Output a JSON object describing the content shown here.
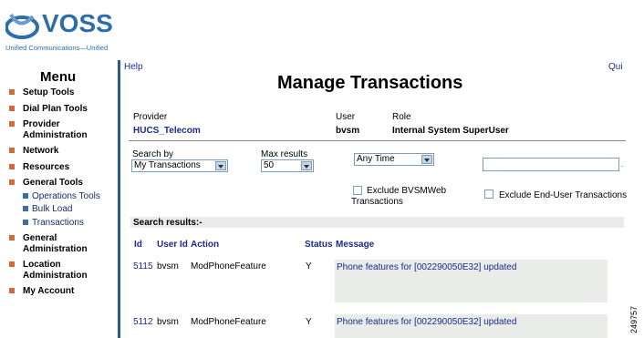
{
  "logo": {
    "word": "VOSS",
    "tagline": "Unified Communications—Unified"
  },
  "menu": {
    "title": "Menu",
    "items": [
      {
        "label": "Setup Tools",
        "sub": false
      },
      {
        "label": "Dial Plan Tools",
        "sub": false
      },
      {
        "label": "Provider Administration",
        "sub": false
      },
      {
        "label": "Network",
        "sub": false
      },
      {
        "label": "Resources",
        "sub": false
      },
      {
        "label": "General Tools",
        "sub": false
      },
      {
        "label": "Operations Tools",
        "sub": true
      },
      {
        "label": "Bulk Load",
        "sub": true
      },
      {
        "label": "Transactions",
        "sub": true
      },
      {
        "label": "General Administration",
        "sub": false
      },
      {
        "label": "Location Administration",
        "sub": false
      },
      {
        "label": "My Account",
        "sub": false
      }
    ]
  },
  "header": {
    "help": "Help",
    "quick": "Qui",
    "title": "Manage Transactions"
  },
  "context": {
    "provider_label": "Provider",
    "provider_value": "HUCS_Telecom",
    "user_label": "User",
    "user_value": "bvsm",
    "role_label": "Role",
    "role_value": "Internal System SuperUser"
  },
  "search": {
    "search_by_label": "Search by",
    "search_by_value": "My Transactions",
    "max_results_label": "Max results",
    "max_results_value": "50",
    "time_value": "Any Time",
    "text_value": "",
    "exclude_bvsmweb": "Exclude BVSMWeb Transactions",
    "exclude_enduser": "Exclude End-User Transactions"
  },
  "results": {
    "title": "Search results:-",
    "columns": {
      "id": "Id",
      "user_id": "User Id",
      "action": "Action",
      "status": "Status",
      "message": "Message"
    },
    "rows": [
      {
        "id": "5115",
        "user": "bvsm",
        "action": "ModPhoneFeature",
        "status": "Y",
        "message": "Phone features for [002290050E32] updated"
      },
      {
        "id": "5112",
        "user": "bvsm",
        "action": "ModPhoneFeature",
        "status": "Y",
        "message": "Phone features for [002290050E32] updated"
      }
    ]
  },
  "figure_number": "249757"
}
